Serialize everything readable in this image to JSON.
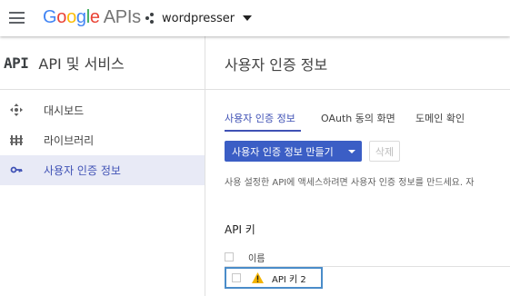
{
  "header": {
    "logo_google": "Google",
    "logo_apis": "APIs",
    "project_name": "wordpresser",
    "brand_colors": [
      "#4285f4",
      "#ea4335",
      "#fbbc05",
      "#4285f4",
      "#34a853",
      "#ea4335"
    ]
  },
  "sidebar": {
    "api_mark": "API",
    "title": "API 및 서비스",
    "items": [
      {
        "label": "대시보드",
        "icon": "dashboard-icon"
      },
      {
        "label": "라이브러리",
        "icon": "library-icon"
      },
      {
        "label": "사용자 인증 정보",
        "icon": "key-icon",
        "active": true
      }
    ]
  },
  "main": {
    "title": "사용자 인증 정보",
    "tabs": [
      {
        "label": "사용자 인증 정보",
        "active": true
      },
      {
        "label": "OAuth 동의 화면",
        "active": false
      },
      {
        "label": "도메인 확인",
        "active": false
      }
    ],
    "create_button": "사용자 인증 정보 만들기",
    "delete_button": "삭제",
    "helper_text": "사용 설정한 API에 액세스하려면 사용자 인증 정보를 만드세요. 자",
    "section_title": "API 키",
    "table": {
      "columns": [
        "이름"
      ],
      "rows": [
        {
          "name": "API 키 2",
          "status_icon": "warning-icon",
          "warning_color": "#f4b400"
        }
      ]
    }
  },
  "colors": {
    "accent": "#3f51b5",
    "button": "#3b5ec5",
    "active_bg": "#e8eaf6",
    "highlight_border": "#4a8cc9"
  }
}
